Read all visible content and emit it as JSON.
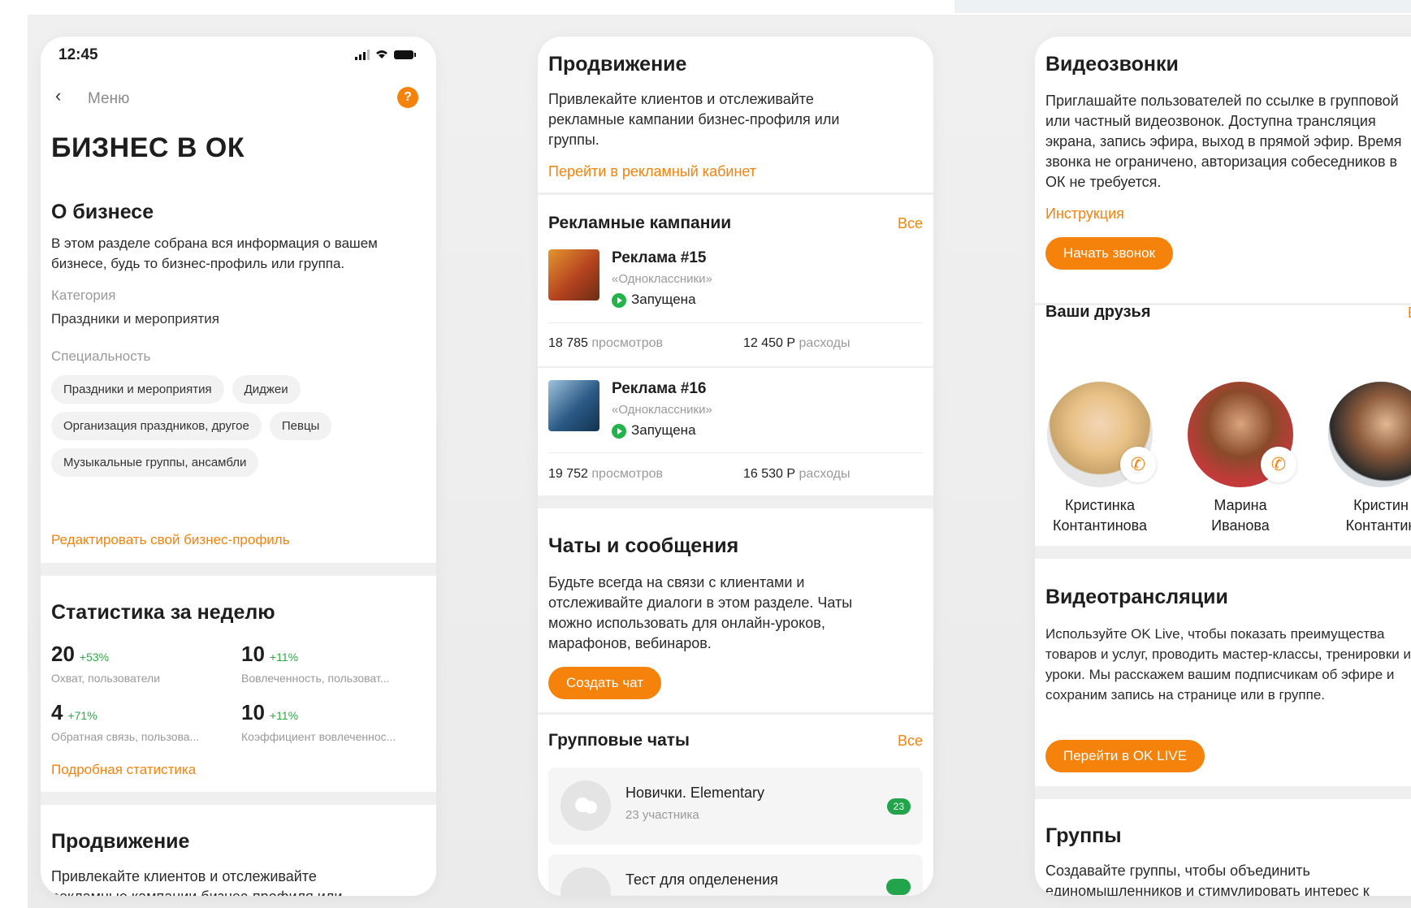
{
  "colors": {
    "accent": "#f5820b",
    "success": "#22b34a",
    "background": "#efefef"
  },
  "phone1": {
    "status_time": "12:45",
    "back_label": "Меню",
    "help_icon": "?",
    "title": "БИЗНЕС В ОК",
    "about": {
      "heading": "О бизнесе",
      "text": "В этом разделе собрана вся информация о вашем бизнесе, будь то бизнес-профиль или группа.",
      "category_label": "Категория",
      "category_value": "Праздники и мероприятия",
      "specialty_label": "Специальность",
      "chips": [
        "Праздники и мероприятия",
        "Диджеи",
        "Организация праздников, другое",
        "Певцы",
        "Музыкальные группы, ансамбли"
      ],
      "edit_link": "Редактировать свой бизнес-профиль"
    },
    "stats": {
      "heading": "Статистика за неделю",
      "items": [
        {
          "value": "20",
          "delta": "+53%",
          "label": "Охват, пользователи"
        },
        {
          "value": "10",
          "delta": "+11%",
          "label": "Вовлеченность, пользоват..."
        },
        {
          "value": "4",
          "delta": "+71%",
          "label": "Обратная связь, пользова..."
        },
        {
          "value": "10",
          "delta": "+11%",
          "label": "Коэффициент вовлеченнос..."
        }
      ],
      "details_link": "Подробная статистика"
    },
    "promo": {
      "heading": "Продвижение",
      "text": "Привлекайте клиентов и отслеживайте рекламные кампании бизнес-профиля или группы."
    }
  },
  "phone2": {
    "promo": {
      "heading": "Продвижение",
      "text": "Привлекайте клиентов и отслеживайте рекламные кампании бизнес-профиля или группы.",
      "link": "Перейти в рекламный кабинет"
    },
    "campaigns": {
      "heading": "Рекламные кампании",
      "all": "Все",
      "items": [
        {
          "title": "Реклама #15",
          "source": "«Одноклассники»",
          "status": "Запущена",
          "views": "18 785",
          "views_label": "просмотров",
          "cost": "12 450 Р",
          "cost_label": "расходы"
        },
        {
          "title": "Реклама #16",
          "source": "«Одноклассники»",
          "status": "Запущена",
          "views": "19 752",
          "views_label": "просмотров",
          "cost": "16 530 Р",
          "cost_label": "расходы"
        }
      ]
    },
    "chats": {
      "heading": "Чаты и сообщения",
      "text": "Будьте всегда на связи с клиентами и отслеживайте диалоги в этом разделе. Чаты можно использовать для онлайн-уроков, марафонов, вебинаров.",
      "button": "Создать чат"
    },
    "group_chats": {
      "heading": "Групповые чаты",
      "all": "Все",
      "items": [
        {
          "title": "Новички. Elementary",
          "subtitle": "23 участника",
          "badge": "23"
        },
        {
          "title": "Тест для опделенения",
          "subtitle": "",
          "badge": ""
        }
      ]
    }
  },
  "phone3": {
    "video_calls": {
      "heading": "Видеозвонки",
      "text": "Приглашайте пользователей по ссылке в групповой или частный видеозвонок. Доступна трансляция экрана, запись эфира, выход в прямой эфир. Время звонка не ограничено, авторизация собеседников в ОК не требуется.",
      "link": "Инструкция",
      "button": "Начать звонок"
    },
    "friends": {
      "heading": "Ваши друзья",
      "all": "Вс",
      "items": [
        {
          "first": "Кристинка",
          "last": "Контантинова"
        },
        {
          "first": "Марина",
          "last": "Иванова"
        },
        {
          "first": "Кристин",
          "last": "Контантин"
        }
      ]
    },
    "streams": {
      "heading": "Видеотрансляции",
      "text": "Используйте OK Live, чтобы показать преимущества товаров и услуг, проводить мастер-классы, тренировки и уроки. Мы расскажем вашим подписчикам об эфире и сохраним запись на странице или в группе.",
      "button": "Перейти в OK LIVE"
    },
    "groups": {
      "heading": "Группы",
      "text": "Создавайте группы, чтобы объединить единомышленников и стимулировать интерес к услугам и товарам. Закрытые группы — это"
    }
  }
}
